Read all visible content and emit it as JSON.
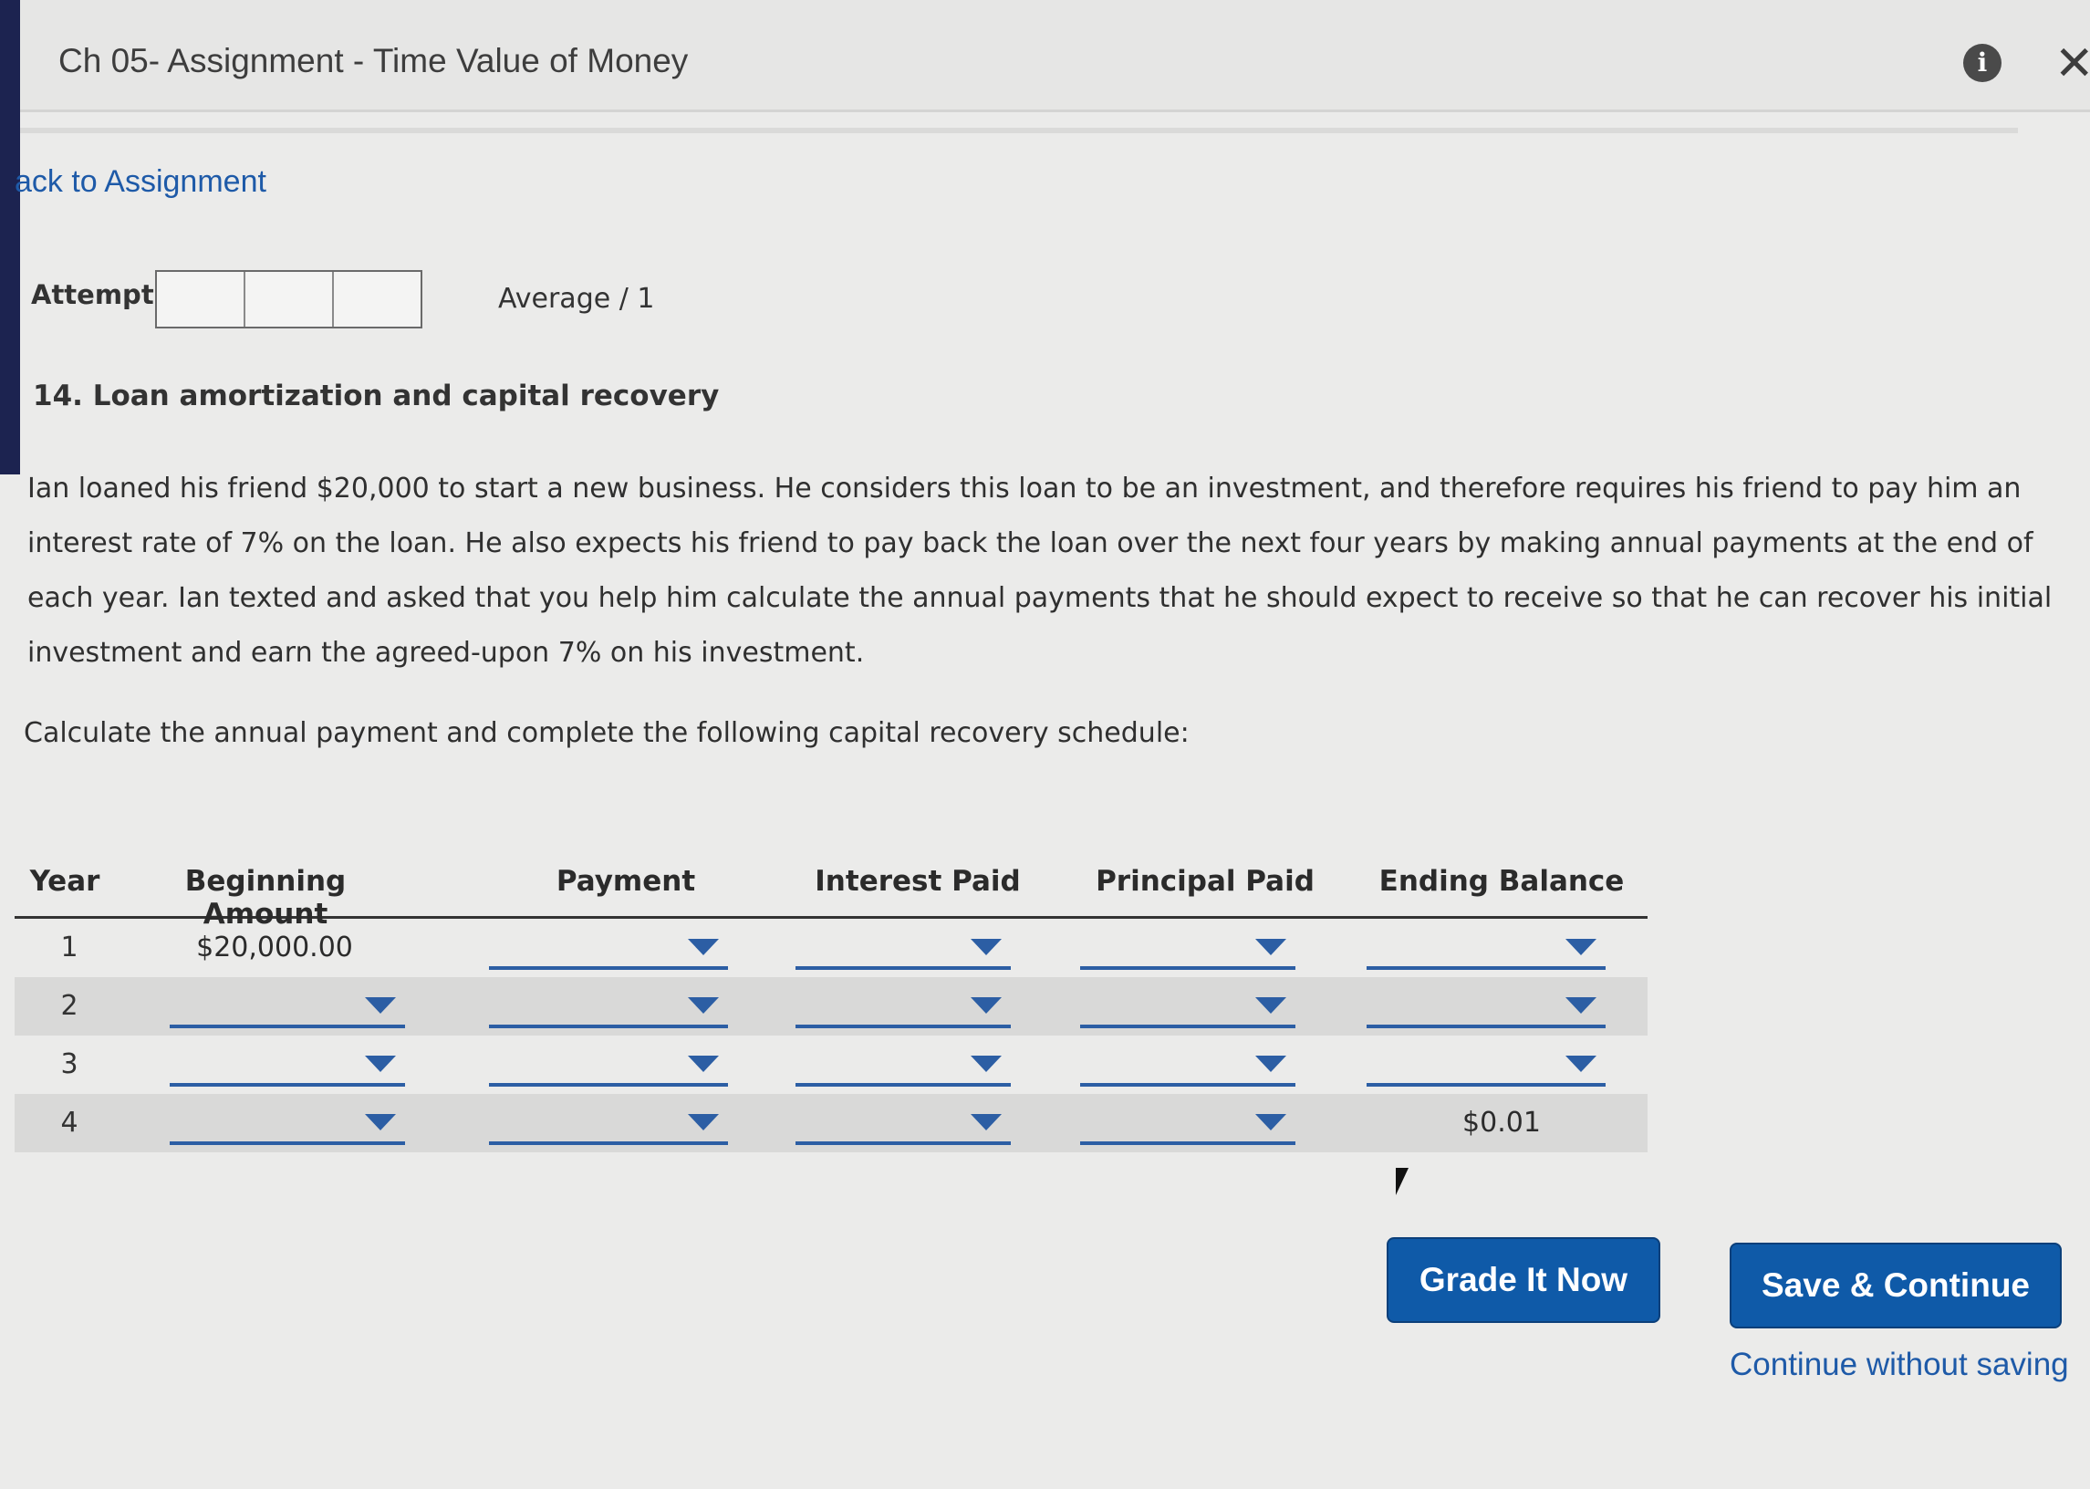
{
  "header": {
    "title": "Ch 05- Assignment - Time Value of Money",
    "info_icon": "info-icon",
    "close_icon": "close-icon"
  },
  "nav": {
    "back_label": "ack to Assignment"
  },
  "attempts": {
    "label": "Attempts",
    "average": "Average / 1"
  },
  "question": {
    "title": "14. Loan amortization and capital recovery",
    "body": "Ian loaned his friend $20,000 to start a new business. He considers this loan to be an investment, and therefore requires his friend to pay him an interest rate of 7% on the loan. He also expects his friend to pay back the loan over the next four years by making annual payments at the end of each year. Ian texted and asked that you help him calculate the annual payments that he should expect to receive so that he can recover his initial investment and earn the agreed-upon 7% on his investment.",
    "instruction": "Calculate the annual payment and complete the following capital recovery schedule:"
  },
  "schedule": {
    "headers": [
      "Year",
      "Beginning Amount",
      "Payment",
      "Interest Paid",
      "Principal Paid",
      "Ending Balance"
    ],
    "rows": [
      {
        "year": "1",
        "beginning": "$20,000.00",
        "ending": ""
      },
      {
        "year": "2",
        "beginning": "",
        "ending": ""
      },
      {
        "year": "3",
        "beginning": "",
        "ending": ""
      },
      {
        "year": "4",
        "beginning": "",
        "ending": "$0.01"
      }
    ]
  },
  "buttons": {
    "grade": "Grade It Now",
    "save": "Save & Continue",
    "continue": "Continue without saving"
  },
  "colors": {
    "accent": "#0f5aa8",
    "link": "#1e5aa8"
  }
}
